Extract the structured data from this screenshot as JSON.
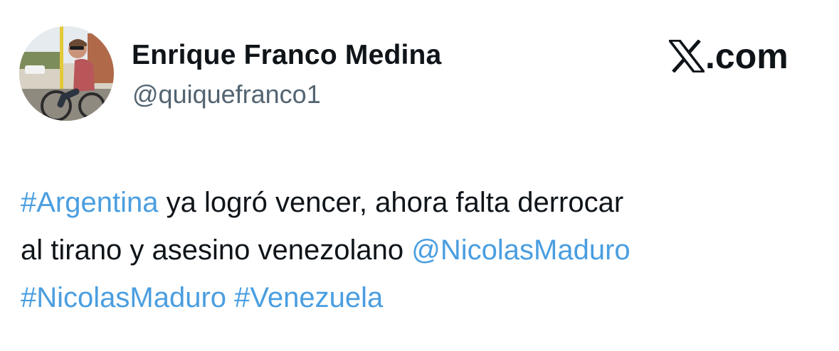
{
  "author": {
    "display_name": "Enrique Franco Medina",
    "handle": "@quiquefranco1",
    "avatar_icon": "profile-photo-cyclist"
  },
  "brand": {
    "icon": "x-logo-icon",
    "text": ".com"
  },
  "tweet": {
    "line1": {
      "hashtag": "#Argentina",
      "text": " ya logró vencer, ahora falta derrocar"
    },
    "line2": {
      "text": "al tirano y asesino venezolano ",
      "mention": "@NicolasMaduro"
    },
    "line3": {
      "hashtag1": "#NicolasMaduro",
      "hashtag2": "#Venezuela"
    }
  },
  "colors": {
    "link": "#4a9ee0",
    "text": "#0f1419",
    "handle": "#536471",
    "background": "#ffffff"
  }
}
